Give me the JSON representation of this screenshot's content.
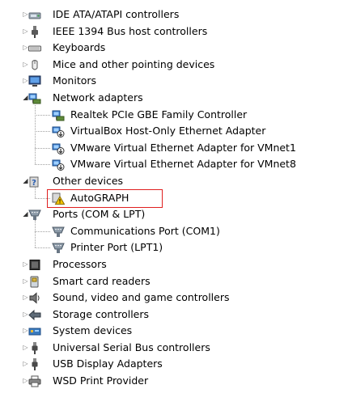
{
  "device_tree": {
    "items": [
      {
        "label": "IDE ATA/ATAPI controllers",
        "icon": "ide-controller-icon",
        "level": 0,
        "expanded": false
      },
      {
        "label": "IEEE 1394 Bus host controllers",
        "icon": "ieee1394-icon",
        "level": 0,
        "expanded": false
      },
      {
        "label": "Keyboards",
        "icon": "keyboard-icon",
        "level": 0,
        "expanded": false
      },
      {
        "label": "Mice and other pointing devices",
        "icon": "mouse-icon",
        "level": 0,
        "expanded": false
      },
      {
        "label": "Monitors",
        "icon": "monitor-icon",
        "level": 0,
        "expanded": false
      },
      {
        "label": "Network adapters",
        "icon": "network-adapter-icon",
        "level": 0,
        "expanded": true
      },
      {
        "label": "Realtek PCIe GBE Family Controller",
        "icon": "network-adapter-icon",
        "level": 1
      },
      {
        "label": "VirtualBox Host-Only Ethernet Adapter",
        "icon": "network-adapter-download-icon",
        "level": 1
      },
      {
        "label": "VMware Virtual Ethernet Adapter for VMnet1",
        "icon": "network-adapter-download-icon",
        "level": 1
      },
      {
        "label": "VMware Virtual Ethernet Adapter for VMnet8",
        "icon": "network-adapter-download-icon",
        "level": 1
      },
      {
        "label": "Other devices",
        "icon": "unknown-device-icon",
        "level": 0,
        "expanded": true
      },
      {
        "label": "AutoGRAPH",
        "icon": "warning-device-icon",
        "level": 1,
        "highlighted": true
      },
      {
        "label": "Ports (COM & LPT)",
        "icon": "port-icon",
        "level": 0,
        "expanded": true
      },
      {
        "label": "Communications Port (COM1)",
        "icon": "port-icon",
        "level": 1
      },
      {
        "label": "Printer Port (LPT1)",
        "icon": "port-icon",
        "level": 1
      },
      {
        "label": "Processors",
        "icon": "processor-icon",
        "level": 0,
        "expanded": false
      },
      {
        "label": "Smart card readers",
        "icon": "smart-card-reader-icon",
        "level": 0,
        "expanded": false
      },
      {
        "label": "Sound, video and game controllers",
        "icon": "speaker-icon",
        "level": 0,
        "expanded": false
      },
      {
        "label": "Storage controllers",
        "icon": "storage-controller-icon",
        "level": 0,
        "expanded": false
      },
      {
        "label": "System devices",
        "icon": "system-device-icon",
        "level": 0,
        "expanded": false
      },
      {
        "label": "Universal Serial Bus controllers",
        "icon": "usb-icon",
        "level": 0,
        "expanded": false
      },
      {
        "label": "USB Display Adapters",
        "icon": "usb-icon",
        "level": 0,
        "expanded": false
      },
      {
        "label": "WSD Print Provider",
        "icon": "printer-icon",
        "level": 0,
        "expanded": false
      }
    ]
  },
  "colors": {
    "highlight_border": "#e02020",
    "tree_line": "#a0a0a0",
    "text": "#000000"
  }
}
